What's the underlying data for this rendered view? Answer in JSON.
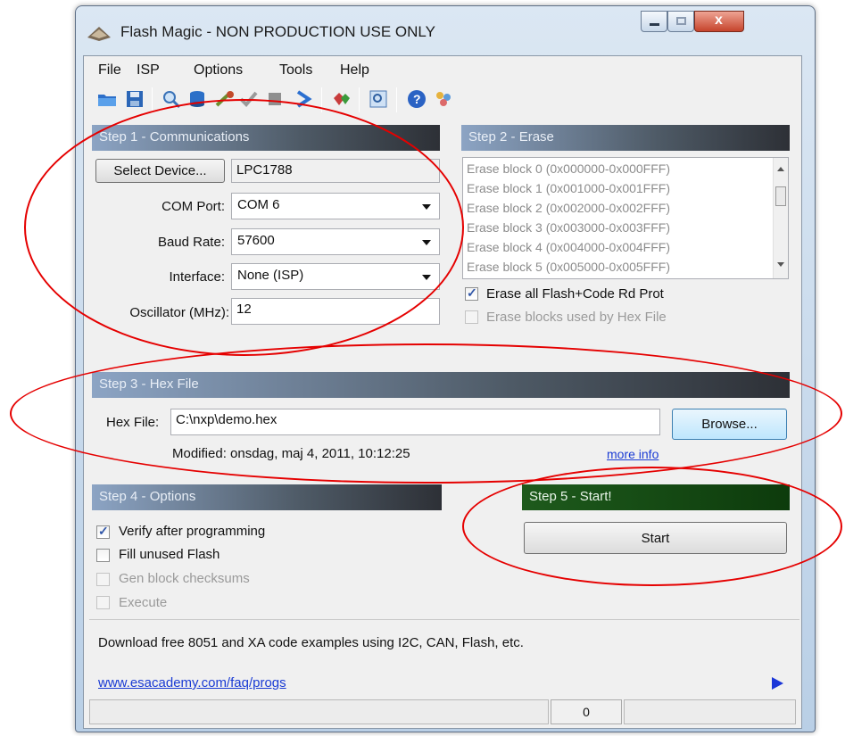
{
  "window": {
    "title": "Flash Magic - NON PRODUCTION USE ONLY"
  },
  "menu": [
    "File",
    "ISP",
    "Options",
    "Tools",
    "Help"
  ],
  "step1": {
    "header": "Step 1 - Communications",
    "select_device_label": "Select Device...",
    "device_value": "LPC1788",
    "com_port_label": "COM Port:",
    "com_port_value": "COM 6",
    "baud_rate_label": "Baud Rate:",
    "baud_rate_value": "57600",
    "interface_label": "Interface:",
    "interface_value": "None (ISP)",
    "oscillator_label": "Oscillator (MHz):",
    "oscillator_value": "12"
  },
  "step2": {
    "header": "Step 2 - Erase",
    "blocks": [
      "Erase block 0 (0x000000-0x000FFF)",
      "Erase block 1 (0x001000-0x001FFF)",
      "Erase block 2 (0x002000-0x002FFF)",
      "Erase block 3 (0x003000-0x003FFF)",
      "Erase block 4 (0x004000-0x004FFF)",
      "Erase block 5 (0x005000-0x005FFF)"
    ],
    "erase_all_label": "Erase all Flash+Code Rd Prot",
    "erase_hex_label": "Erase blocks used by Hex File"
  },
  "step3": {
    "header": "Step 3 - Hex File",
    "hex_file_label": "Hex File:",
    "hex_file_value": "C:\\nxp\\demo.hex",
    "browse_label": "Browse...",
    "modified_text": "Modified: onsdag, maj 4, 2011, 10:12:25",
    "more_info_label": "more info"
  },
  "step4": {
    "header": "Step 4 - Options",
    "verify_label": "Verify after programming",
    "fill_label": "Fill unused Flash",
    "gen_label": "Gen block checksums",
    "execute_label": "Execute"
  },
  "step5": {
    "header": "Step 5 - Start!",
    "start_label": "Start"
  },
  "footer": {
    "message": "Download free 8051 and XA code examples using I2C, CAN, Flash, etc.",
    "link": "www.esacademy.com/faq/progs"
  },
  "status": {
    "count": "0"
  },
  "colors": {
    "annotation": "#e50000",
    "step5": "#1e5a1c",
    "link": "#1a3bd4"
  }
}
